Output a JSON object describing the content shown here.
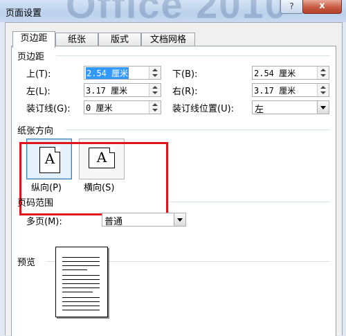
{
  "window": {
    "title": "页面设置",
    "watermark": "Office 2010",
    "help_label": "?",
    "close_label": "x"
  },
  "tabs": [
    {
      "label": "页边距",
      "active": true
    },
    {
      "label": "纸张",
      "active": false
    },
    {
      "label": "版式",
      "active": false
    },
    {
      "label": "文档网格",
      "active": false
    }
  ],
  "margins": {
    "group_label": "页边距",
    "top_label": "上(T):",
    "top_value": "2.54 厘米",
    "bottom_label": "下(B):",
    "bottom_value": "2.54 厘米",
    "left_label": "左(L):",
    "left_value": "3.17 厘米",
    "right_label": "右(R):",
    "right_value": "3.17 厘米",
    "gutter_label": "装订线(G):",
    "gutter_value": "0 厘米",
    "gutter_pos_label": "装订线位置(U):",
    "gutter_pos_value": "左"
  },
  "orientation": {
    "group_label": "纸张方向",
    "letter": "A",
    "portrait_label": "纵向(P)",
    "landscape_label": "横向(S)",
    "selected": "portrait"
  },
  "pages": {
    "group_label": "页码范围",
    "multiple_label": "多页(M):",
    "multiple_value": "普通"
  },
  "preview": {
    "group_label": "预览"
  }
}
